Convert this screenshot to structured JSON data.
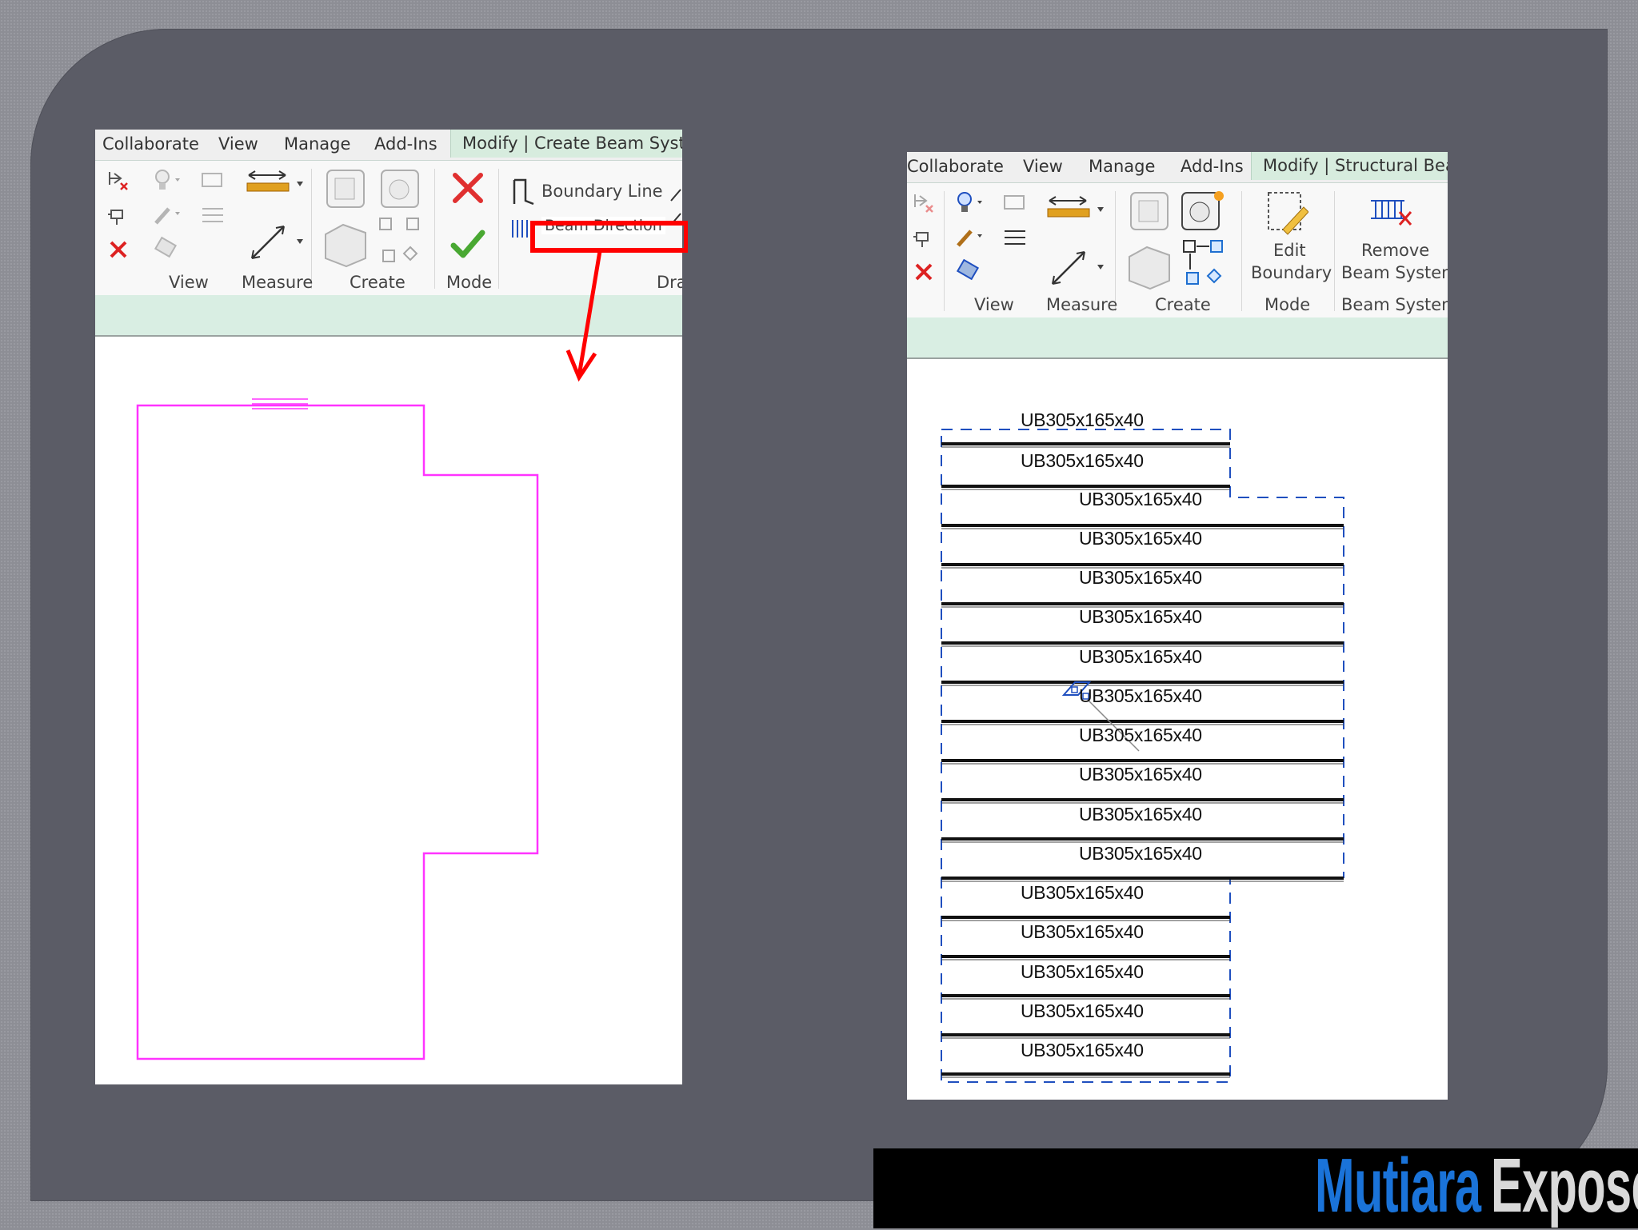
{
  "left_panel": {
    "tabs": [
      "Collaborate",
      "View",
      "Manage",
      "Add-Ins",
      "Modify | Create Beam System"
    ],
    "active_tab": "Modify | Create Beam System",
    "panel_labels": {
      "view": "View",
      "measure": "Measure",
      "create": "Create",
      "mode": "Mode",
      "draw": "Draw"
    },
    "draw_tools": {
      "boundary_line": "Boundary Line",
      "beam_direction": "Beam Direction"
    },
    "highlight_color": "#ff0000",
    "boundary_color": "#ff33ff"
  },
  "right_panel": {
    "tabs": [
      "Collaborate",
      "View",
      "Manage",
      "Add-Ins",
      "Modify | Structural Beam"
    ],
    "active_tab": "Modify | Structural Beam",
    "panel_labels": {
      "view": "View",
      "measure": "Measure",
      "create": "Create",
      "mode": "Mode",
      "beam_system": "Beam System"
    },
    "buttons": {
      "edit_boundary_1": "Edit",
      "edit_boundary_2": "Boundary",
      "remove_beam_system_1": "Remove",
      "remove_beam_system_2": "Beam System"
    },
    "beam_labels": [
      "UB305x165x40",
      "UB305x165x40",
      "UB305x165x40",
      "UB305x165x40",
      "UB305x165x40",
      "UB305x165x40",
      "UB305x165x40",
      "UB305x165x40",
      "UB305x165x40",
      "UB305x165x40",
      "UB305x165x40",
      "UB305x165x40",
      "UB305x165x40",
      "UB305x165x40",
      "UB305x165x40",
      "UB305x165x40",
      "UB305x165x40"
    ],
    "beam_system_boundary_color": "#1f4fbf"
  },
  "logo": {
    "word1": "Mutiara",
    "word2": "Expose",
    "word1_color": "#1a73d9",
    "word2_color": "#d9d9d9"
  }
}
